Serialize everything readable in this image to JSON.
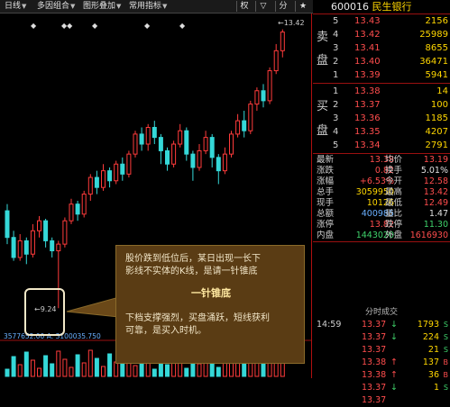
{
  "toolbar": {
    "items": [
      "日线",
      "多因组合",
      "图形叠加",
      "常用指标"
    ],
    "right_buttons": [
      "权",
      "▽",
      "分",
      "★"
    ]
  },
  "chart": {
    "high_label": "13.42",
    "low_label": "9.24",
    "volume_label": "3577652.00  A: 3100035.750"
  },
  "callout": {
    "line1": "股价跌到低位后，某日出现一长下",
    "line2": "影线不实体的K线，是请一针锥底",
    "title": "一针锥底",
    "line3": "下档支撑强烈，买盘涌跃，短线获利",
    "line4": "可靠，是买入时机。"
  },
  "quote": {
    "code": "600016",
    "name": "民生银行",
    "sell_label_1": "卖",
    "sell_label_2": "盘",
    "buy_label_1": "买",
    "buy_label_2": "盘",
    "asks": [
      {
        "level": "5",
        "price": "13.43",
        "vol": "2156"
      },
      {
        "level": "4",
        "price": "13.42",
        "vol": "25989"
      },
      {
        "level": "3",
        "price": "13.41",
        "vol": "8655"
      },
      {
        "level": "2",
        "price": "13.40",
        "vol": "36471"
      },
      {
        "level": "1",
        "price": "13.39",
        "vol": "5941"
      }
    ],
    "bids": [
      {
        "level": "1",
        "price": "13.38",
        "vol": "14"
      },
      {
        "level": "2",
        "price": "13.37",
        "vol": "100"
      },
      {
        "level": "3",
        "price": "13.36",
        "vol": "1185"
      },
      {
        "level": "4",
        "price": "13.35",
        "vol": "4207"
      },
      {
        "level": "5",
        "price": "13.34",
        "vol": "2791"
      }
    ],
    "stats": [
      {
        "l1": "最新",
        "v1": "13.38",
        "l2": "均价",
        "v2": "13.19"
      },
      {
        "l1": "涨跌",
        "v1": "0.82",
        "l2": "换手",
        "v2": "5.01%"
      },
      {
        "l1": "涨幅",
        "v1": "+6.53%",
        "l2": "今开",
        "v2": "12.58"
      },
      {
        "l1": "总手",
        "v1": "3059950",
        "l2": "最高",
        "v2": "13.42"
      },
      {
        "l1": "现手",
        "v1": "10126",
        "l2": "最低",
        "v2": "12.49"
      },
      {
        "l1": "总额",
        "v1": "400985",
        "l2": "量比",
        "v2": "1.47"
      },
      {
        "l1": "涨停",
        "v1": "13.82",
        "l2": "跌停",
        "v2": "11.30"
      },
      {
        "l1": "内盘",
        "v1": "1443020",
        "l2": "外盘",
        "v2": "1616930"
      }
    ],
    "ticks_header": "分时成交",
    "ticks": [
      {
        "time": "14:59",
        "price": "13.37",
        "arrow": "↓",
        "vol": "1793",
        "side": "S"
      },
      {
        "time": "",
        "price": "13.37",
        "arrow": "↓",
        "vol": "224",
        "side": "S"
      },
      {
        "time": "",
        "price": "13.37",
        "arrow": "",
        "vol": "21",
        "side": "S"
      },
      {
        "time": "",
        "price": "13.38",
        "arrow": "↑",
        "vol": "137",
        "side": "B"
      },
      {
        "time": "",
        "price": "13.38",
        "arrow": "↑",
        "vol": "36",
        "side": "B"
      },
      {
        "time": "",
        "price": "13.37",
        "arrow": "↓",
        "vol": "1",
        "side": "S"
      },
      {
        "time": "",
        "price": "13.37",
        "arrow": "",
        "vol": "",
        "side": ""
      }
    ]
  }
}
